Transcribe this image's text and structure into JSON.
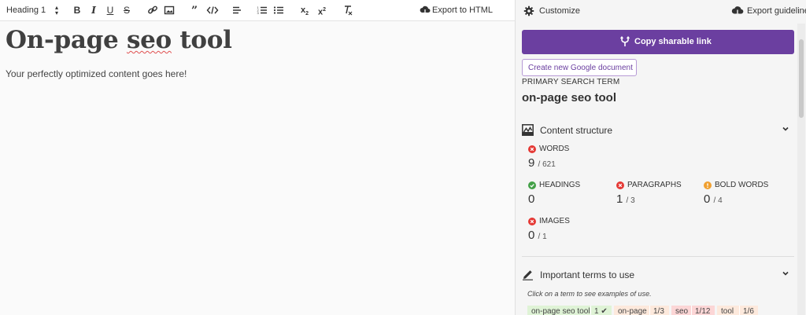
{
  "toolbar": {
    "heading_select": "Heading 1",
    "export_html": "Export to HTML"
  },
  "document": {
    "title_part1": "On-page ",
    "title_part2": "seo",
    "title_part3": " tool",
    "body": "Your perfectly optimized content goes here!"
  },
  "sidebar": {
    "customize": "Customize",
    "export_guidelines": "Export guidelines",
    "copy_link": "Copy sharable link",
    "new_google_doc": "Create new Google document",
    "primary_label": "PRIMARY SEARCH TERM",
    "primary_value": "on-page seo tool",
    "content_structure": {
      "title": "Content structure",
      "words": {
        "label": "WORDS",
        "value": "9",
        "target": "/ 621",
        "status": "bad"
      },
      "headings": {
        "label": "HEADINGS",
        "value": "0",
        "target": "",
        "status": "good"
      },
      "paragraphs": {
        "label": "PARAGRAPHS",
        "value": "1",
        "target": "/ 3",
        "status": "bad"
      },
      "bold_words": {
        "label": "BOLD WORDS",
        "value": "0",
        "target": "/ 4",
        "status": "warn"
      },
      "images": {
        "label": "IMAGES",
        "value": "0",
        "target": "/ 1",
        "status": "bad"
      }
    },
    "important_terms": {
      "title": "Important terms to use",
      "hint": "Click on a term to see examples of use.",
      "terms": [
        {
          "name": "on-page seo tool",
          "count": "1 ✔",
          "status": "ok"
        },
        {
          "name": "on-page",
          "count": "1/3",
          "status": "mid"
        },
        {
          "name": "seo",
          "count": "1/12",
          "status": "low"
        },
        {
          "name": "tool",
          "count": "1/6",
          "status": "mid"
        }
      ]
    }
  },
  "colors": {
    "accent": "#6b3fa0",
    "bad": "#e53935",
    "good": "#43a047",
    "warn": "#f0a030"
  },
  "icons": [
    "bold-icon",
    "italic-icon",
    "underline-icon",
    "strikethrough-icon",
    "link-icon",
    "image-icon",
    "quote-icon",
    "code-icon",
    "align-left-icon",
    "ordered-list-icon",
    "bullet-list-icon",
    "subscript-icon",
    "superscript-icon",
    "clear-format-icon",
    "cloud-download-icon",
    "gear-icon",
    "branch-icon",
    "chart-icon",
    "pencil-icon",
    "chevron-down-icon"
  ]
}
